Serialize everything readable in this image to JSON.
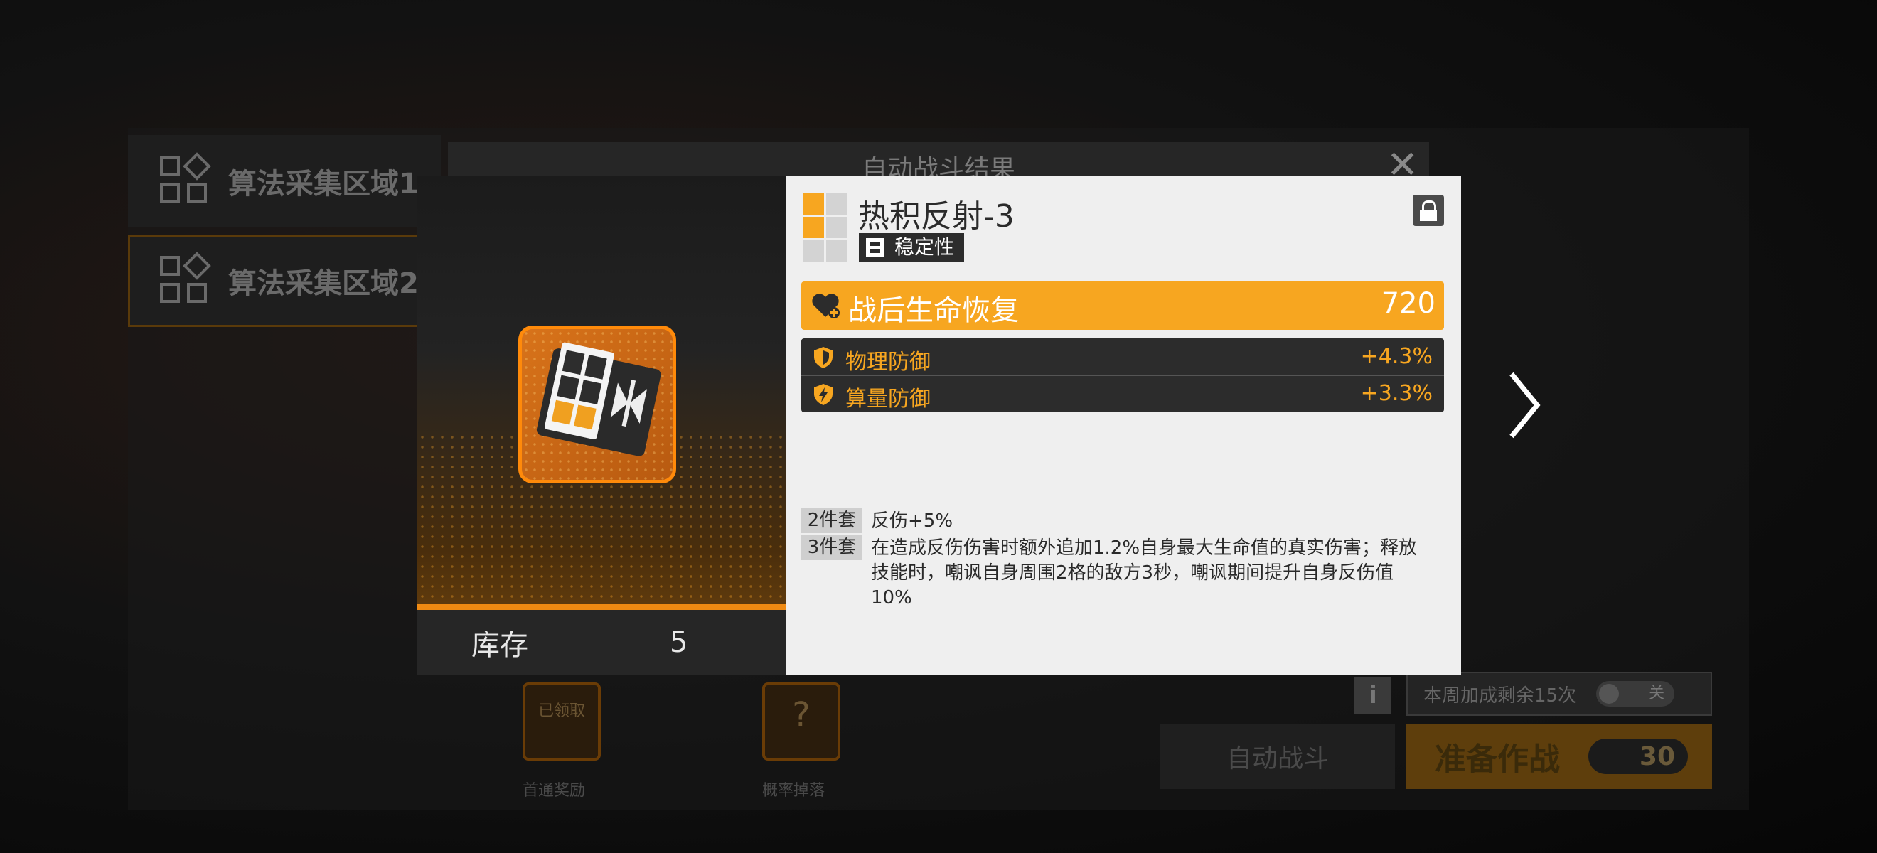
{
  "background": {
    "areas": [
      {
        "label": "算法采集区域1"
      },
      {
        "label": "算法采集区域2"
      }
    ],
    "dialog_title": "自动战斗结果",
    "close_glyph": "✕",
    "rewards": [
      {
        "status": "已领取",
        "label": "首通奖励"
      },
      {
        "status": "?",
        "label": "概率掉落"
      }
    ],
    "info_glyph": "i",
    "bonus_text": "本周加成剩余15次",
    "bonus_toggle": "关",
    "auto_battle_label": "自动战斗",
    "prepare_label": "准备作战",
    "cost": "30"
  },
  "item": {
    "stock_label": "库存",
    "stock_value": "5",
    "name": "热积反射-3",
    "tag": "稳定性",
    "main_stat": {
      "name": "战后生命恢复",
      "value": "720"
    },
    "sub_stats": [
      {
        "name": "物理防御",
        "value": "+4.3%",
        "icon": "shield-icon"
      },
      {
        "name": "算量防御",
        "value": "+3.3%",
        "icon": "lightning-shield-icon"
      }
    ],
    "set_bonuses": [
      {
        "badge": "2件套",
        "desc": "反伤+5%"
      },
      {
        "badge": "3件套",
        "desc": "在造成反伤伤害时额外追加1.2%自身最大生命值的真实伤害；释放技能时，嘲讽自身周围2格的敌方3秒，嘲讽期间提升自身反伤值10%"
      }
    ]
  },
  "colors": {
    "accent": "#f7a620",
    "dark": "#2c2c2c",
    "panel": "#efefef"
  }
}
